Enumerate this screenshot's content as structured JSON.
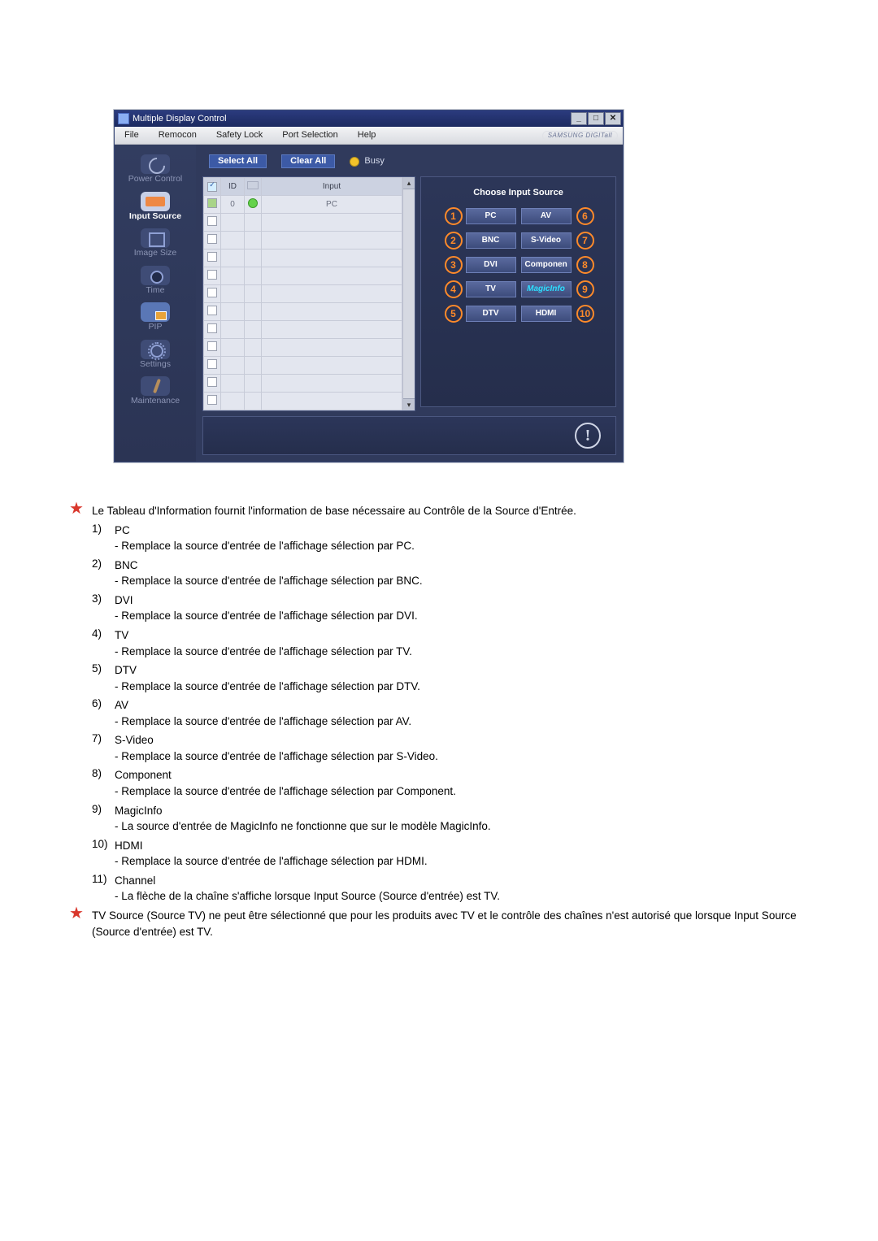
{
  "app": {
    "title": "Multiple Display Control",
    "win_min": "_",
    "win_max": "□",
    "win_close": "✕",
    "brand": "SAMSUNG DIGITall"
  },
  "menu": {
    "file": "File",
    "remocon": "Remocon",
    "safety": "Safety Lock",
    "port": "Port Selection",
    "help": "Help"
  },
  "sidebar": {
    "power": "Power Control",
    "input": "Input Source",
    "size": "Image Size",
    "time": "Time",
    "pip": "PIP",
    "settings": "Settings",
    "maint": "Maintenance"
  },
  "toolbar": {
    "select_all": "Select All",
    "clear_all": "Clear All",
    "busy": "Busy"
  },
  "grid": {
    "col_id": "ID",
    "col_input": "Input",
    "row0_id": "0",
    "row0_input": "PC"
  },
  "panel": {
    "title": "Choose Input Source",
    "n1": "1",
    "b1": "PC",
    "n2": "2",
    "b2": "BNC",
    "n3": "3",
    "b3": "DVI",
    "n4": "4",
    "b4": "TV",
    "n5": "5",
    "b5": "DTV",
    "n6": "6",
    "b6": "AV",
    "n7": "7",
    "b7": "S-Video",
    "n8": "8",
    "b8": "Componen",
    "n9": "9",
    "b9": "MagicInfo",
    "n10": "10",
    "b10": "HDMI"
  },
  "info_icon": "!",
  "doc": {
    "intro": "Le Tableau d'Information fournit l'information de base nécessaire au Contrôle de la Source d'Entrée.",
    "items": [
      {
        "n": "1)",
        "label": "PC",
        "desc": "- Remplace la source d'entrée de l'affichage sélection par PC."
      },
      {
        "n": "2)",
        "label": "BNC",
        "desc": "- Remplace la source d'entrée de l'affichage sélection par BNC."
      },
      {
        "n": "3)",
        "label": "DVI",
        "desc": "- Remplace la source d'entrée de l'affichage sélection par DVI."
      },
      {
        "n": "4)",
        "label": "TV",
        "desc": "- Remplace la source d'entrée de l'affichage sélection par TV."
      },
      {
        "n": "5)",
        "label": "DTV",
        "desc": "- Remplace la source d'entrée de l'affichage sélection par DTV."
      },
      {
        "n": "6)",
        "label": "AV",
        "desc": "- Remplace la source d'entrée de l'affichage sélection par AV."
      },
      {
        "n": "7)",
        "label": "S-Video",
        "desc": "- Remplace la source d'entrée de l'affichage sélection par S-Video."
      },
      {
        "n": "8)",
        "label": "Component",
        "desc": "- Remplace la source d'entrée de l'affichage sélection par Component."
      },
      {
        "n": "9)",
        "label": "MagicInfo",
        "desc": "- La source d'entrée de MagicInfo ne fonctionne que sur le modèle MagicInfo."
      },
      {
        "n": "10)",
        "label": "HDMI",
        "desc": "- Remplace la source d'entrée de l'affichage sélection par HDMI."
      },
      {
        "n": "11)",
        "label": "Channel",
        "desc": "- La flèche de la chaîne s'affiche lorsque Input Source (Source d'entrée) est TV."
      }
    ],
    "footnote": "TV Source (Source TV) ne peut être sélectionné que pour les produits avec TV et le contrôle des chaînes n'est autorisé que lorsque Input Source (Source d'entrée) est TV."
  }
}
